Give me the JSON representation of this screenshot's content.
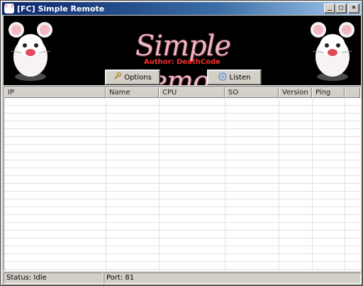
{
  "window": {
    "title": "[FC] Simple Remote",
    "controls": {
      "minimize": "_",
      "maximize": "□",
      "close": "×"
    }
  },
  "banner": {
    "logo_text": "Simple Remote",
    "author": "Author: DeathCode",
    "buttons": {
      "options": {
        "label": "Options",
        "icon": "wrench-icon"
      },
      "listen": {
        "label": "Listen",
        "icon": "signal-icon"
      }
    }
  },
  "list": {
    "columns": [
      "IP",
      "Name",
      "CPU",
      "SO",
      "Version",
      "Ping"
    ],
    "rows": []
  },
  "status": {
    "state": "Status: Idle",
    "port": "Port: 81"
  }
}
